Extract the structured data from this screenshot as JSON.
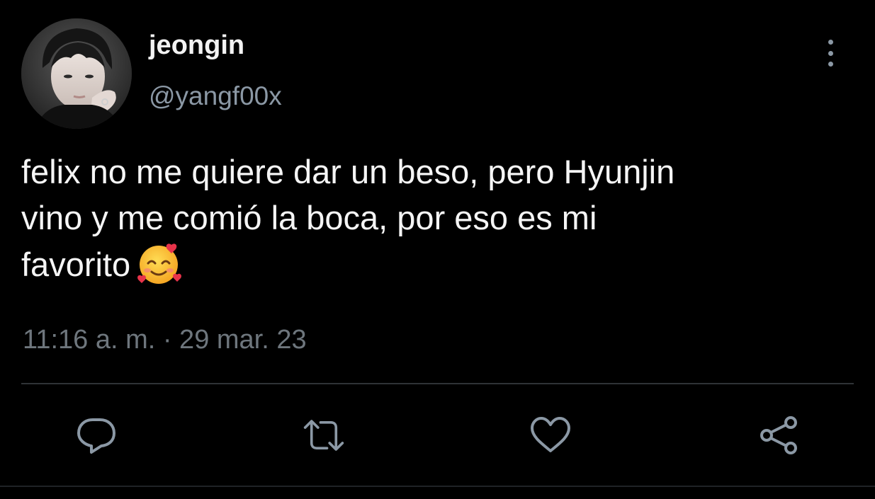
{
  "author": {
    "display_name": "jeongin",
    "handle": "@yangf00x",
    "avatar_icon": "profile-photo"
  },
  "tweet": {
    "text_line1": "felix no me quiere dar un beso, pero Hyunjin",
    "text_line2": "vino y me comió la boca, por eso es mi",
    "text_line3": "favorito",
    "emoji": "smiling-face-with-hearts-icon",
    "timestamp": "11:16 a. m. · 29 mar. 23"
  },
  "actions": {
    "reply_icon": "reply-icon",
    "retweet_icon": "retweet-icon",
    "like_icon": "heart-icon",
    "share_icon": "share-icon"
  },
  "colors": {
    "background": "#000000",
    "primary_text": "#f5f5f5",
    "secondary_text": "#8b98a5",
    "icon": "#8b98a5",
    "divider": "#2f3336"
  }
}
